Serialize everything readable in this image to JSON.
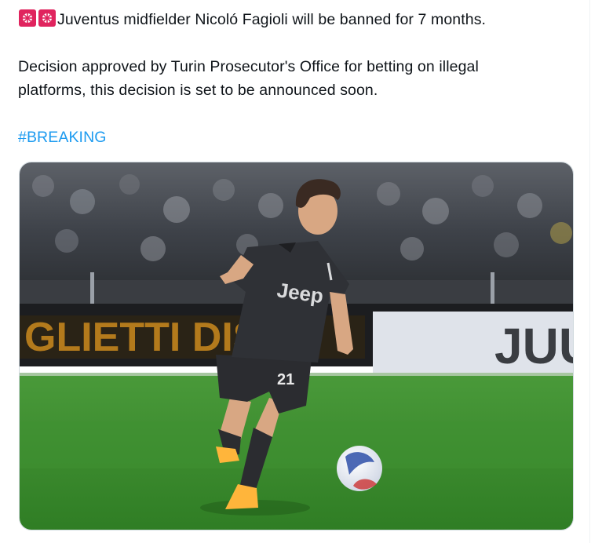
{
  "tweet": {
    "emoji": [
      "rotating-light-icon",
      "rotating-light-icon"
    ],
    "headline": "Juventus midfielder Nicoló Fagioli will be banned for 7 months.",
    "body_line1": "Decision approved by Turin Prosecutor's Office for betting on illegal",
    "body_line2": "platforms, this decision is set to be announced soon.",
    "hashtag": "#BREAKING"
  },
  "media": {
    "description_icon": "football-photo",
    "jersey_brand": "Jeep",
    "jersey_number": "21",
    "board_text_left": "GLIETTI DISP",
    "board_text_right": "JUU"
  },
  "colors": {
    "hashtag": "#1d9bf0",
    "text": "#0f1419",
    "pitch": "#3a8a2e",
    "kit": "#2f3136"
  }
}
